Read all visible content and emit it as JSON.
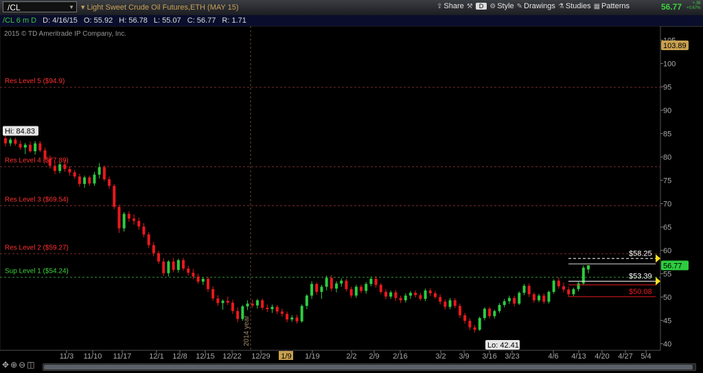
{
  "toolbar": {
    "symbol": "/CL",
    "description": "Light Sweet Crude Oil Futures,ETH (MAY 15)",
    "share": "Share",
    "d_button": "D",
    "style": "Style",
    "drawings": "Drawings",
    "studies": "Studies",
    "patterns": "Patterns",
    "last_price": "56.77",
    "change_abs": "+.38",
    "change_pct": "+0.67%"
  },
  "infobar": {
    "symbol_period": "/CL 6 m D",
    "date": "D: 4/16/15",
    "open": "O: 55.92",
    "high": "H: 56.78",
    "low": "L: 55.07",
    "close": "C: 56.77",
    "range": "R: 1.71"
  },
  "copyright": "2015 © TD Ameritrade IP Company, Inc.",
  "colors": {
    "up": "#2ecc40",
    "down": "#e8191e",
    "res": "#ff3030",
    "sup": "#3ed13e"
  },
  "chart_data": {
    "type": "candlestick",
    "y_axis_ticks": [
      40,
      45,
      50,
      55,
      60,
      65,
      70,
      75,
      80,
      85,
      90,
      95,
      100,
      105
    ],
    "ylim": [
      38,
      108.4
    ],
    "x_ticks": [
      "11/3",
      "11/10",
      "11/17",
      "12/1",
      "12/8",
      "12/15",
      "12/22",
      "12/29",
      "1/9",
      "1/19",
      "2/2",
      "2/9",
      "2/16",
      "3/2",
      "3/9",
      "3/16",
      "3/23",
      "4/6",
      "4/13",
      "4/20",
      "4/27",
      "5/4"
    ],
    "year_marker": "2014 year",
    "horizontal_levels": [
      {
        "label": "Res Level 5 ($94.9)",
        "value": 94.9,
        "kind": "res"
      },
      {
        "label": "Res Level 4 ($77.89)",
        "value": 77.89,
        "kind": "res"
      },
      {
        "label": "Res Level 3 ($69.54)",
        "value": 69.54,
        "kind": "res"
      },
      {
        "label": "Res Level 2 ($59.27)",
        "value": 59.27,
        "kind": "res"
      },
      {
        "label": "Sup Level 1 ($54.24)",
        "value": 54.24,
        "kind": "sup"
      }
    ],
    "price_lines": [
      {
        "label": "$58.25",
        "value": 58.25,
        "style": "dashed",
        "color": "#ffffff",
        "arrow": true
      },
      {
        "label": "",
        "value": 57.1,
        "style": "solid",
        "color": "#dddddd",
        "arrow": false
      },
      {
        "label": "$53.39",
        "value": 53.39,
        "style": "solid",
        "color": "#ffffff",
        "arrow": true
      },
      {
        "label": "",
        "value": 52.6,
        "style": "solid",
        "color": "#e8191e",
        "arrow": false
      },
      {
        "label": "$50.08",
        "value": 50.08,
        "style": "solid",
        "color": "#e8191e",
        "arrow": false
      }
    ],
    "annotations": {
      "hi": "Hi: 84.83",
      "lo": "Lo: 42.41"
    },
    "axis_badges": {
      "top": "103.89",
      "last": "56.77"
    },
    "candles": [
      [
        84.0,
        84.8,
        82.2,
        82.9
      ],
      [
        82.9,
        84.1,
        82.3,
        83.7
      ],
      [
        83.7,
        84.1,
        82.4,
        82.8
      ],
      [
        82.8,
        83.5,
        81.5,
        82.0
      ],
      [
        82.0,
        83.0,
        80.6,
        82.6
      ],
      [
        82.6,
        83.3,
        80.9,
        81.2
      ],
      [
        81.2,
        83.4,
        80.5,
        82.9
      ],
      [
        82.9,
        83.4,
        81.0,
        81.4
      ],
      [
        81.4,
        82.0,
        79.0,
        79.6
      ],
      [
        79.6,
        80.3,
        77.5,
        78.1
      ],
      [
        78.1,
        79.0,
        76.3,
        77.0
      ],
      [
        77.0,
        78.8,
        76.5,
        78.4
      ],
      [
        78.4,
        79.1,
        76.8,
        77.4
      ],
      [
        77.4,
        78.0,
        76.0,
        76.7
      ],
      [
        76.7,
        77.2,
        75.3,
        75.8
      ],
      [
        75.8,
        76.4,
        73.6,
        74.2
      ],
      [
        74.2,
        76.0,
        73.4,
        75.6
      ],
      [
        75.6,
        76.0,
        73.8,
        74.3
      ],
      [
        74.3,
        76.8,
        73.8,
        76.2
      ],
      [
        76.2,
        78.7,
        75.4,
        77.8
      ],
      [
        77.8,
        78.2,
        74.8,
        75.2
      ],
      [
        75.2,
        75.8,
        73.2,
        73.8
      ],
      [
        73.8,
        74.2,
        68.8,
        69.3
      ],
      [
        69.3,
        69.8,
        63.7,
        64.7
      ],
      [
        64.7,
        68.2,
        64.0,
        67.8
      ],
      [
        67.8,
        68.4,
        66.1,
        66.8
      ],
      [
        66.8,
        67.7,
        65.5,
        66.3
      ],
      [
        66.3,
        67.0,
        64.4,
        65.1
      ],
      [
        65.1,
        65.8,
        62.8,
        63.4
      ],
      [
        63.4,
        63.9,
        60.5,
        61.1
      ],
      [
        61.1,
        61.8,
        58.7,
        59.4
      ],
      [
        59.4,
        59.9,
        57.1,
        57.6
      ],
      [
        57.6,
        58.3,
        54.5,
        55.1
      ],
      [
        55.1,
        57.9,
        54.4,
        57.6
      ],
      [
        57.6,
        58.4,
        55.3,
        55.8
      ],
      [
        55.8,
        58.2,
        55.2,
        57.9
      ],
      [
        57.9,
        58.4,
        55.6,
        56.1
      ],
      [
        56.1,
        56.7,
        54.6,
        55.2
      ],
      [
        55.2,
        56.0,
        53.8,
        54.4
      ],
      [
        54.4,
        55.0,
        52.8,
        53.3
      ],
      [
        53.3,
        54.3,
        52.6,
        53.9
      ],
      [
        53.9,
        54.4,
        51.1,
        51.7
      ],
      [
        51.7,
        52.3,
        49.2,
        49.7
      ],
      [
        49.7,
        50.4,
        48.1,
        48.7
      ],
      [
        48.7,
        49.5,
        47.3,
        49.2
      ],
      [
        49.2,
        50.1,
        48.3,
        48.8
      ],
      [
        48.8,
        49.4,
        46.4,
        47.0
      ],
      [
        47.0,
        47.8,
        44.6,
        45.3
      ],
      [
        45.3,
        48.3,
        44.9,
        48.0
      ],
      [
        48.0,
        49.3,
        47.2,
        48.6
      ],
      [
        48.6,
        49.5,
        47.7,
        48.2
      ],
      [
        48.2,
        49.6,
        47.5,
        49.3
      ],
      [
        49.3,
        49.7,
        47.2,
        47.7
      ],
      [
        47.7,
        48.4,
        46.8,
        47.4
      ],
      [
        47.4,
        48.4,
        46.6,
        47.9
      ],
      [
        47.9,
        48.3,
        46.3,
        46.9
      ],
      [
        46.9,
        47.5,
        45.8,
        46.4
      ],
      [
        46.4,
        46.9,
        44.6,
        45.2
      ],
      [
        45.2,
        46.1,
        44.7,
        45.6
      ],
      [
        45.6,
        46.2,
        44.3,
        44.8
      ],
      [
        44.8,
        48.4,
        44.5,
        48.1
      ],
      [
        48.1,
        50.6,
        47.4,
        50.3
      ],
      [
        50.3,
        53.4,
        49.6,
        52.8
      ],
      [
        52.8,
        53.1,
        50.5,
        51.1
      ],
      [
        51.1,
        52.6,
        49.6,
        52.2
      ],
      [
        52.2,
        54.6,
        51.4,
        54.1
      ],
      [
        54.1,
        54.7,
        51.2,
        51.8
      ],
      [
        51.8,
        53.4,
        51.0,
        52.9
      ],
      [
        52.9,
        54.0,
        52.2,
        53.5
      ],
      [
        53.5,
        53.9,
        51.2,
        51.7
      ],
      [
        51.7,
        52.2,
        49.8,
        50.3
      ],
      [
        50.3,
        52.6,
        49.8,
        52.2
      ],
      [
        52.2,
        52.7,
        50.8,
        51.3
      ],
      [
        51.3,
        53.2,
        50.7,
        52.8
      ],
      [
        52.8,
        54.4,
        52.3,
        53.9
      ],
      [
        53.9,
        54.5,
        52.0,
        52.6
      ],
      [
        52.6,
        53.0,
        50.6,
        51.1
      ],
      [
        51.1,
        51.7,
        49.5,
        50.1
      ],
      [
        50.1,
        51.4,
        49.6,
        51.0
      ],
      [
        51.0,
        51.5,
        49.2,
        49.8
      ],
      [
        49.8,
        50.3,
        48.7,
        49.3
      ],
      [
        49.3,
        50.8,
        48.8,
        50.3
      ],
      [
        50.3,
        51.3,
        49.6,
        50.9
      ],
      [
        50.9,
        51.4,
        49.9,
        50.4
      ],
      [
        50.4,
        50.9,
        49.2,
        49.6
      ],
      [
        49.6,
        51.8,
        49.1,
        51.4
      ],
      [
        51.4,
        51.9,
        50.2,
        50.8
      ],
      [
        50.8,
        51.3,
        49.6,
        50.0
      ],
      [
        50.0,
        50.6,
        48.4,
        49.0
      ],
      [
        49.0,
        49.5,
        47.3,
        47.9
      ],
      [
        47.9,
        49.8,
        47.4,
        49.3
      ],
      [
        49.3,
        49.8,
        47.6,
        48.1
      ],
      [
        48.1,
        48.6,
        45.5,
        46.1
      ],
      [
        46.1,
        46.6,
        44.3,
        44.9
      ],
      [
        44.9,
        45.4,
        42.9,
        43.5
      ],
      [
        43.5,
        44.0,
        42.4,
        43.0
      ],
      [
        43.0,
        45.8,
        42.7,
        45.5
      ],
      [
        45.5,
        47.8,
        45.0,
        47.5
      ],
      [
        47.5,
        47.9,
        45.4,
        45.9
      ],
      [
        45.9,
        47.3,
        45.4,
        47.0
      ],
      [
        47.0,
        48.7,
        46.6,
        48.3
      ],
      [
        48.3,
        49.6,
        47.8,
        49.1
      ],
      [
        49.1,
        50.3,
        48.5,
        49.8
      ],
      [
        49.8,
        50.3,
        48.0,
        48.6
      ],
      [
        48.6,
        51.2,
        48.3,
        50.9
      ],
      [
        50.9,
        52.8,
        50.4,
        52.4
      ],
      [
        52.4,
        52.9,
        50.0,
        50.6
      ],
      [
        50.6,
        51.0,
        48.8,
        49.3
      ],
      [
        49.3,
        50.7,
        48.9,
        50.3
      ],
      [
        50.3,
        50.8,
        48.6,
        49.0
      ],
      [
        49.0,
        51.4,
        48.6,
        51.1
      ],
      [
        51.1,
        53.8,
        50.7,
        53.5
      ],
      [
        53.5,
        54.2,
        51.8,
        52.3
      ],
      [
        52.3,
        53.1,
        51.0,
        51.6
      ],
      [
        51.6,
        52.2,
        50.1,
        50.6
      ],
      [
        50.6,
        52.0,
        50.2,
        51.7
      ],
      [
        51.7,
        53.3,
        51.2,
        52.9
      ],
      [
        52.9,
        56.8,
        52.5,
        56.3
      ],
      [
        55.9,
        56.8,
        55.1,
        56.8
      ]
    ]
  }
}
